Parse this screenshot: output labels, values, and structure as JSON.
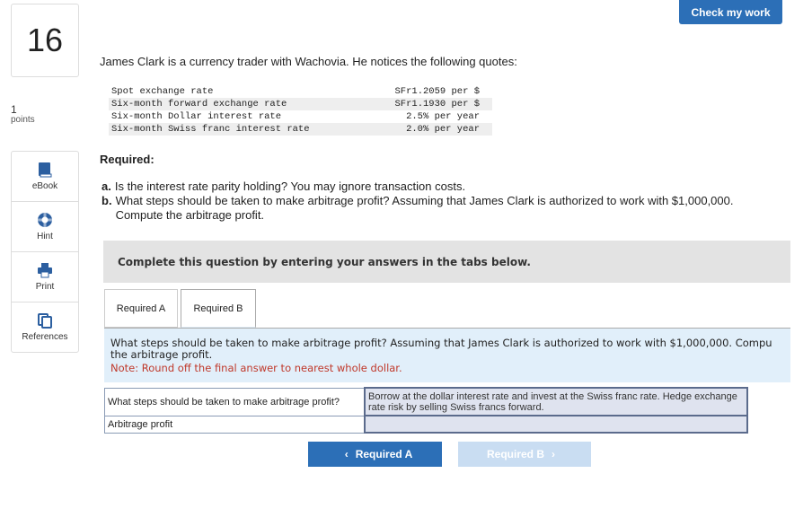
{
  "header": {
    "check_button": "Check my work"
  },
  "question": {
    "number": "16",
    "points_value": "1",
    "points_label": "points"
  },
  "tools": [
    {
      "label": "eBook",
      "icon": "book-icon"
    },
    {
      "label": "Hint",
      "icon": "lifebuoy-icon"
    },
    {
      "label": "Print",
      "icon": "printer-icon"
    },
    {
      "label": "References",
      "icon": "copy-icon"
    }
  ],
  "problem": {
    "intro": "James Clark is a currency trader with Wachovia. He notices the following quotes:",
    "quotes": [
      {
        "label": "Spot exchange rate",
        "value": "SFr1.2059 per $"
      },
      {
        "label": "Six-month forward exchange rate",
        "value": "SFr1.1930 per $"
      },
      {
        "label": "Six-month Dollar interest rate",
        "value": "2.5% per year"
      },
      {
        "label": "Six-month Swiss franc interest rate",
        "value": "2.0% per year"
      }
    ],
    "required_heading": "Required:",
    "parts": [
      {
        "letter": "a.",
        "text": "Is the interest rate parity holding? You may ignore transaction costs."
      },
      {
        "letter": "b.",
        "text": "What steps should be taken to make arbitrage profit? Assuming that James Clark is authorized to work with $1,000,000. Compute the arbitrage profit."
      }
    ]
  },
  "complete_banner": "Complete this question by entering your answers in the tabs below.",
  "tabs": [
    {
      "label": "Required A"
    },
    {
      "label": "Required B"
    }
  ],
  "content": {
    "question_line1": "What steps should be taken to make arbitrage profit? Assuming that James Clark is authorized to work with $1,000,000. Compu",
    "question_line2": "the arbitrage profit.",
    "note": "Note: Round off the final answer to nearest whole dollar."
  },
  "answers": [
    {
      "question": "What steps should be taken to make arbitrage profit?",
      "value": "Borrow at the dollar interest rate and invest at the Swiss franc rate. Hedge exchange rate risk by selling Swiss francs forward."
    },
    {
      "question": "Arbitrage profit",
      "value": ""
    }
  ],
  "nav": {
    "prev_label": "Required A",
    "next_label": "Required B"
  },
  "colors": {
    "accent": "#2c6fb7",
    "note_red": "#c0392b",
    "content_bg": "#e1effa"
  }
}
